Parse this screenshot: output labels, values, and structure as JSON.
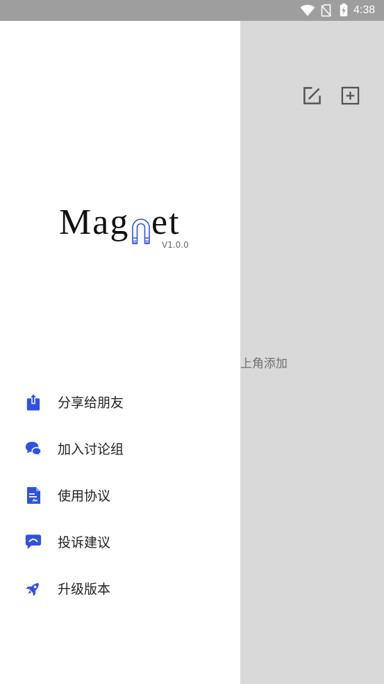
{
  "status_bar": {
    "time": "4:38",
    "icons": [
      "wifi-icon",
      "no-sim-icon",
      "battery-charging-icon"
    ]
  },
  "drawer": {
    "logo": {
      "prefix": "Mag",
      "suffix": "et",
      "icon": "magnet-icon",
      "version": "V1.0.0"
    },
    "menu": [
      {
        "label": "分享给朋友",
        "icon": "share-icon"
      },
      {
        "label": "加入讨论组",
        "icon": "chat-icon"
      },
      {
        "label": "使用协议",
        "icon": "document-icon"
      },
      {
        "label": "投诉建议",
        "icon": "feedback-icon"
      },
      {
        "label": "升级版本",
        "icon": "rocket-icon"
      }
    ]
  },
  "main": {
    "toolbar_icons": [
      "edit-icon",
      "add-box-icon"
    ],
    "hint_text": "上角添加"
  },
  "colors": {
    "accent": "#2f52e0",
    "status_bar": "#9e9e9e",
    "scrim": "#d9d9d9",
    "text": "#222222",
    "muted": "#6f6f6f",
    "icon_gray": "#555555"
  }
}
